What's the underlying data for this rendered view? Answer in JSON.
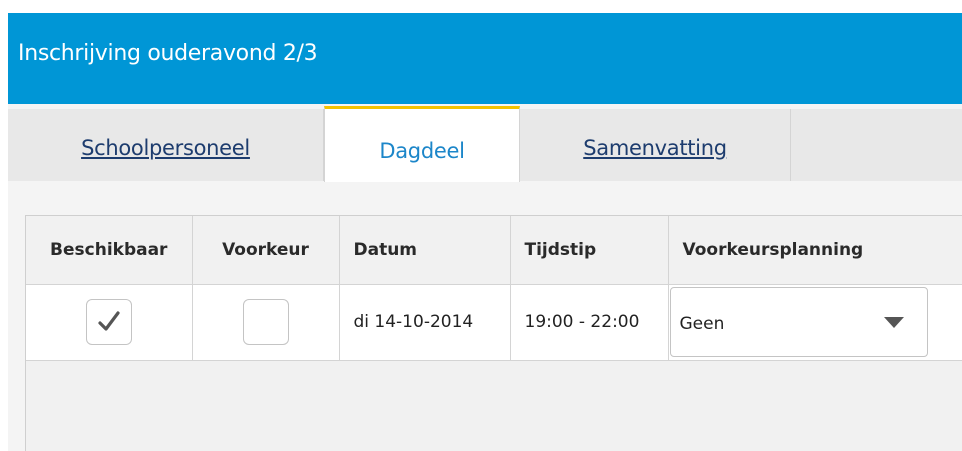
{
  "window": {
    "title": "Inschrijving ouderavond 2/3"
  },
  "tabs": [
    {
      "label": "Schoolpersoneel",
      "active": false
    },
    {
      "label": "Dagdeel",
      "active": true
    },
    {
      "label": "Samenvatting",
      "active": false
    }
  ],
  "table": {
    "headers": [
      "Beschikbaar",
      "Voorkeur",
      "Datum",
      "Tijdstip",
      "Voorkeursplanning"
    ],
    "rows": [
      {
        "beschikbaar": true,
        "voorkeur": false,
        "datum": "di 14-10-2014",
        "tijdstip": "19:00 - 22:00",
        "voorkeursplanning": "Geen"
      }
    ]
  },
  "colors": {
    "title_bar": "#0096d6",
    "active_tab_accent": "#f2c200",
    "tab_link": "#1d3c6e",
    "active_tab_text": "#1c86c9"
  },
  "icons": {
    "checkmark": "check-icon",
    "dropdown": "caret-down-icon"
  }
}
